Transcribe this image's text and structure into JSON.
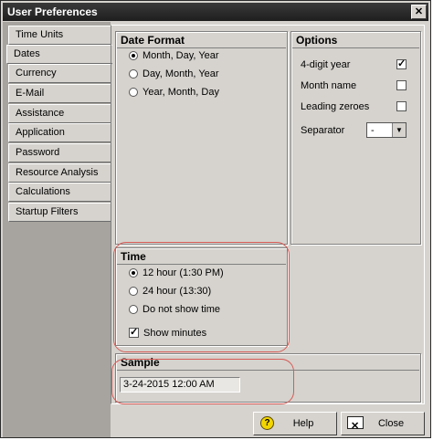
{
  "window": {
    "title": "User Preferences"
  },
  "tabs": [
    {
      "label": "Time Units"
    },
    {
      "label": "Dates"
    },
    {
      "label": "Currency"
    },
    {
      "label": "E-Mail"
    },
    {
      "label": "Assistance"
    },
    {
      "label": "Application"
    },
    {
      "label": "Password"
    },
    {
      "label": "Resource Analysis"
    },
    {
      "label": "Calculations"
    },
    {
      "label": "Startup Filters"
    }
  ],
  "active_tab": "Dates",
  "date_format": {
    "title": "Date Format",
    "options": [
      {
        "label": "Month, Day, Year",
        "selected": true
      },
      {
        "label": "Day, Month, Year",
        "selected": false
      },
      {
        "label": "Year, Month, Day",
        "selected": false
      }
    ]
  },
  "options": {
    "title": "Options",
    "four_digit_year": {
      "label": "4-digit year",
      "checked": true
    },
    "month_name": {
      "label": "Month name",
      "checked": false
    },
    "leading_zeroes": {
      "label": "Leading zeroes",
      "checked": false
    },
    "separator": {
      "label": "Separator",
      "value": "-"
    }
  },
  "time": {
    "title": "Time",
    "options": [
      {
        "label": "12 hour (1:30 PM)",
        "selected": true
      },
      {
        "label": "24 hour (13:30)",
        "selected": false
      },
      {
        "label": "Do not show time",
        "selected": false
      }
    ],
    "show_minutes": {
      "label": "Show minutes",
      "checked": true
    }
  },
  "sample": {
    "title": "Sample",
    "value": "3-24-2015 12:00 AM"
  },
  "buttons": {
    "help": "Help",
    "close": "Close"
  },
  "colors": {
    "dialog_bg": "#d6d3ce",
    "highlight_oval": "#d65a55",
    "title_bar": "#2a2a2a"
  }
}
